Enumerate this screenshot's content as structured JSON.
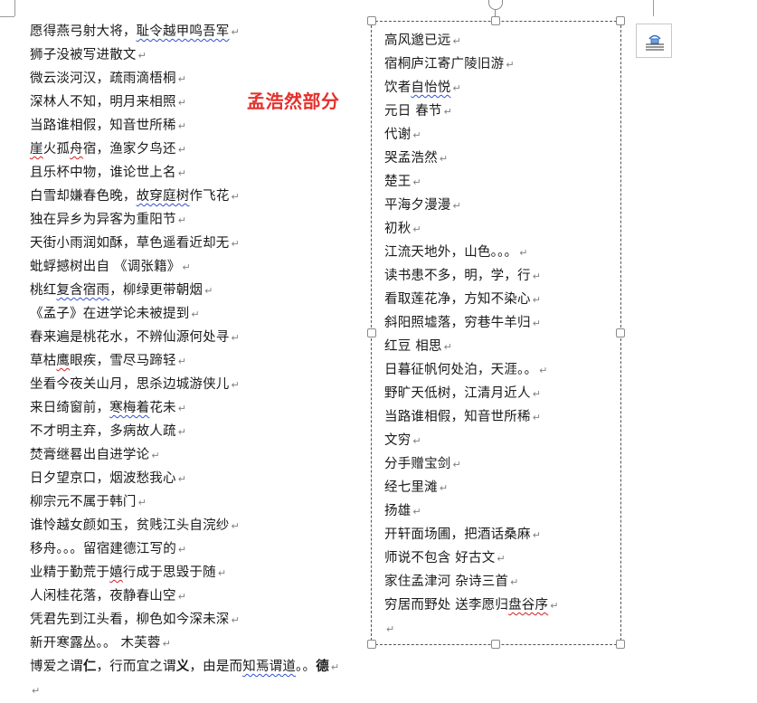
{
  "left_lines": [
    {
      "segments": [
        {
          "t": "愿得燕弓射大将，"
        },
        {
          "t": "耻令越甲鸣吾军",
          "s": "wavyblue"
        }
      ]
    },
    {
      "segments": [
        {
          "t": "狮子没被写进散文"
        }
      ]
    },
    {
      "segments": [
        {
          "t": "微云淡河汉，疏雨滴梧桐"
        }
      ]
    },
    {
      "segments": [
        {
          "t": "深林人不知，明月来相照"
        }
      ]
    },
    {
      "segments": [
        {
          "t": "当路谁相假，知音世所稀"
        }
      ]
    },
    {
      "segments": [
        {
          "t": "崖",
          "s": "wavy"
        },
        {
          "t": "火孤"
        },
        {
          "t": "舟",
          "s": "wavy"
        },
        {
          "t": "宿，渔家夕鸟还"
        }
      ]
    },
    {
      "segments": [
        {
          "t": "且乐杯中物，谁论世上名"
        }
      ]
    },
    {
      "segments": [
        {
          "t": "白雪却嫌春色晚，"
        },
        {
          "t": "故穿庭树",
          "s": "wavyblue"
        },
        {
          "t": "作飞花"
        }
      ]
    },
    {
      "segments": [
        {
          "t": "独在异乡为异客为重阳节"
        }
      ]
    },
    {
      "segments": [
        {
          "t": "天街小雨润如酥，草色遥看近却无"
        }
      ]
    },
    {
      "segments": [
        {
          "t": "蚍蜉撼树出自  《调张籍》"
        }
      ]
    },
    {
      "segments": [
        {
          "t": "桃红"
        },
        {
          "t": "复含宿雨",
          "s": "wavyblue"
        },
        {
          "t": "，柳绿更带朝烟"
        }
      ]
    },
    {
      "segments": [
        {
          "t": "《孟子》在进学论未被提到"
        }
      ]
    },
    {
      "segments": [
        {
          "t": "春来遍是桃花水，不辨仙源何处寻"
        }
      ]
    },
    {
      "segments": [
        {
          "t": "草枯"
        },
        {
          "t": "鹰",
          "s": "wavy"
        },
        {
          "t": "眼疾，雪尽马蹄轻"
        }
      ]
    },
    {
      "segments": [
        {
          "t": "坐看今夜关山月，思杀边城游侠儿"
        }
      ]
    },
    {
      "segments": [
        {
          "t": "来日绮窗前，"
        },
        {
          "t": "寒梅着",
          "s": "wavyblue"
        },
        {
          "t": "花未"
        }
      ]
    },
    {
      "segments": [
        {
          "t": "不才明主弃，多病故人疏"
        }
      ]
    },
    {
      "segments": [
        {
          "t": "焚膏继晷出自进学论"
        }
      ]
    },
    {
      "segments": [
        {
          "t": "日夕望京口，烟波愁我心"
        }
      ]
    },
    {
      "segments": [
        {
          "t": "柳宗元不属于韩门"
        }
      ]
    },
    {
      "segments": [
        {
          "t": "谁怜越女颜如玉，贫贱江头自浣纱"
        }
      ]
    },
    {
      "segments": [
        {
          "t": "移舟。。。留宿建德江写的"
        }
      ]
    },
    {
      "segments": [
        {
          "t": "业精于勤荒于"
        },
        {
          "t": "嬉",
          "s": "wavy"
        },
        {
          "t": "行成于思毁于随"
        }
      ]
    },
    {
      "segments": [
        {
          "t": "人闲桂花落，夜静春山空"
        }
      ]
    },
    {
      "segments": [
        {
          "t": "凭君先到江头看，柳色如今深未深"
        }
      ]
    },
    {
      "segments": [
        {
          "t": "新开寒露丛。。  木芙蓉"
        }
      ]
    },
    {
      "segments": [
        {
          "t": "博爱之谓"
        },
        {
          "t": "仁",
          "s": "bold"
        },
        {
          "t": "，行而宜之谓"
        },
        {
          "t": "义",
          "s": "bold"
        },
        {
          "t": "，由是而"
        },
        {
          "t": "知焉谓道",
          "s": "wavyblue"
        },
        {
          "t": "。。"
        },
        {
          "t": "德",
          "s": "bold"
        }
      ]
    },
    {
      "segments": [
        {
          "t": ""
        }
      ]
    }
  ],
  "annotation": "孟浩然部分",
  "box_lines": [
    {
      "segments": [
        {
          "t": "高风邈已远"
        }
      ]
    },
    {
      "segments": [
        {
          "t": "宿桐庐江寄广陵旧游"
        }
      ]
    },
    {
      "segments": [
        {
          "t": "饮者"
        },
        {
          "t": "自怡悦",
          "s": "wavyblue"
        }
      ]
    },
    {
      "segments": [
        {
          "t": "元日  春节"
        }
      ]
    },
    {
      "segments": [
        {
          "t": "代谢"
        }
      ]
    },
    {
      "segments": [
        {
          "t": "哭孟浩然"
        }
      ]
    },
    {
      "segments": [
        {
          "t": "楚王"
        }
      ]
    },
    {
      "segments": [
        {
          "t": "平海夕漫漫"
        }
      ]
    },
    {
      "segments": [
        {
          "t": "初秋"
        }
      ]
    },
    {
      "segments": [
        {
          "t": "江流天地外，山色。。。"
        }
      ]
    },
    {
      "segments": [
        {
          "t": "读书患不多，明，学，行"
        }
      ]
    },
    {
      "segments": [
        {
          "t": "看取莲花净，方知不染心"
        }
      ]
    },
    {
      "segments": [
        {
          "t": "斜阳照墟落，穷巷牛羊归"
        }
      ]
    },
    {
      "segments": [
        {
          "t": "红豆  相思"
        }
      ]
    },
    {
      "segments": [
        {
          "t": "日暮征帆何处泊，天涯。。"
        }
      ]
    },
    {
      "segments": [
        {
          "t": "野旷天低树，江清月近人"
        }
      ]
    },
    {
      "segments": [
        {
          "t": "当路谁相假，知音世所稀"
        }
      ]
    },
    {
      "segments": [
        {
          "t": "文穷"
        }
      ]
    },
    {
      "segments": [
        {
          "t": "分手赠宝剑"
        }
      ]
    },
    {
      "segments": [
        {
          "t": "经七里滩"
        }
      ]
    },
    {
      "segments": [
        {
          "t": "扬雄"
        }
      ]
    },
    {
      "segments": [
        {
          "t": "开轩面场圃，把酒话桑麻"
        }
      ]
    },
    {
      "segments": [
        {
          "t": "师说不包含  好古文"
        }
      ]
    },
    {
      "segments": [
        {
          "t": "家住孟津河  杂诗三首"
        }
      ]
    },
    {
      "segments": [
        {
          "t": "穷居而野处  送李愿归"
        },
        {
          "t": "盘谷序",
          "s": "wavy"
        }
      ]
    },
    {
      "segments": [
        {
          "t": ""
        }
      ]
    }
  ],
  "paragraph_mark": "↵",
  "icons": {
    "layout_options": "layout-options-icon"
  },
  "colors": {
    "annotation": "#e5302c",
    "spell_error": "#d02020",
    "grammar_flag": "#3050d0"
  }
}
